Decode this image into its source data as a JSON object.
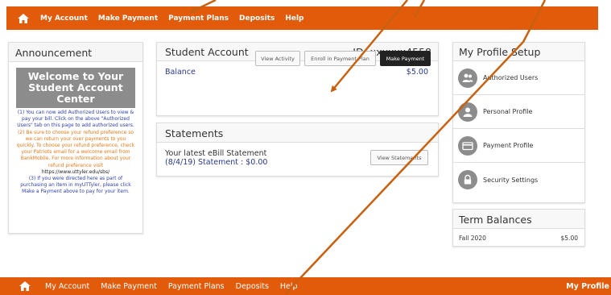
{
  "nav": {
    "home_icon": "home-icon",
    "items": [
      "My Account",
      "Make Payment",
      "Payment Plans",
      "Deposits",
      "Help"
    ]
  },
  "bottom_nav": {
    "items": [
      "My Account",
      "Make Payment",
      "Payment Plans",
      "Deposits",
      "Help"
    ],
    "right_item": "My Profile"
  },
  "announcement": {
    "title": "Announcement",
    "welcome_lines": [
      "Welcome to Your",
      "Student Account",
      "Center"
    ],
    "p1": "(1) You can now add Authorized Users to view & pay your bill. Click on the above \"Authorized Users\" tab on this page to add authorized users.",
    "p2": "(2) Be sure to choose your refund preference so we can return your over payments to you quickly. To choose your refund preference, check your Patriots email for a welcome email from BankMobile. For more information about your refund preference visit",
    "p2_link": "https://www.uttyler.edu/sbs/",
    "p3": "(3) If you were directed here as part of purchasing an item in myUTTyler, please click Make a Payment above to pay for your item."
  },
  "student_account": {
    "title": "Student Account",
    "id_label": "ID: xxxxxx4558",
    "balance_label": "Balance",
    "balance_value": "$5.00",
    "buttons": {
      "view_activity": "View Activity",
      "enroll": "Enroll in Payment Plan",
      "make_payment": "Make Payment"
    }
  },
  "statements": {
    "title": "Statements",
    "latest_label": "Your latest eBill Statement",
    "statement_line": "(8/4/19) Statement :   $0.00",
    "view_button": "View Statements"
  },
  "profile": {
    "title": "My Profile Setup",
    "items": [
      {
        "label": "Authorized Users",
        "icon": "users-icon"
      },
      {
        "label": "Personal Profile",
        "icon": "person-icon"
      },
      {
        "label": "Payment Profile",
        "icon": "credit-card-icon"
      },
      {
        "label": "Security Settings",
        "icon": "lock-icon"
      }
    ]
  },
  "term_balances": {
    "title": "Term Balances",
    "rows": [
      {
        "term": "Fall 2020",
        "amount": "$5.00"
      }
    ]
  },
  "colors": {
    "nav_bg": "#e15b0a",
    "arrow": "#c8610f",
    "dark_button": "#222222",
    "welcome_box": "#8c8c8c"
  }
}
